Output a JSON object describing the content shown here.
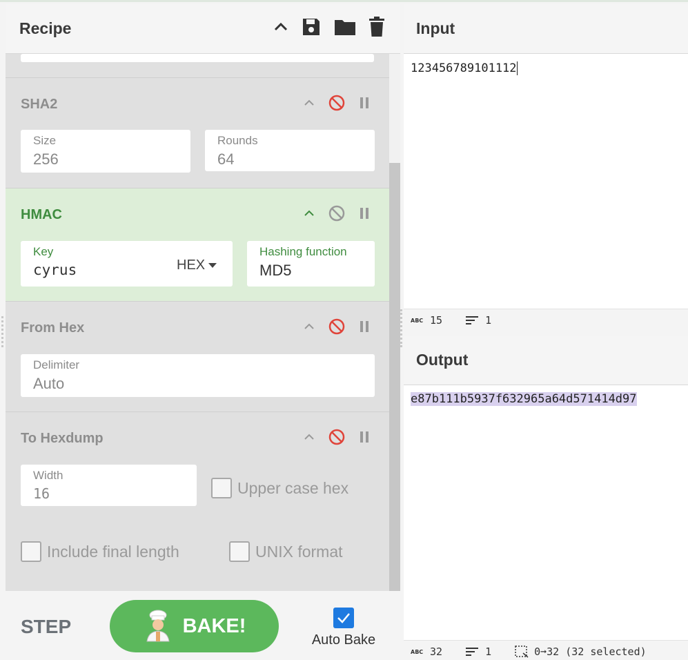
{
  "recipe": {
    "title": "Recipe",
    "operations": [
      {
        "name": "SHA2",
        "fields": [
          {
            "label": "Size",
            "value": "256"
          },
          {
            "label": "Rounds",
            "value": "64"
          }
        ]
      },
      {
        "name": "HMAC",
        "fields": [
          {
            "label": "Key",
            "value": "cyrus",
            "encoding": "HEX"
          },
          {
            "label": "Hashing function",
            "value": "MD5"
          }
        ]
      },
      {
        "name": "From Hex",
        "fields": [
          {
            "label": "Delimiter",
            "value": "Auto"
          }
        ]
      },
      {
        "name": "To Hexdump",
        "fields": [
          {
            "label": "Width",
            "value": "16"
          }
        ],
        "checkboxes": [
          {
            "label": "Upper case hex",
            "checked": false
          },
          {
            "label": "Include final length",
            "checked": false
          },
          {
            "label": "UNIX format",
            "checked": false
          }
        ]
      }
    ]
  },
  "controls": {
    "step_label": "STEP",
    "bake_label": "BAKE!",
    "auto_bake_label": "Auto Bake",
    "auto_bake_checked": true
  },
  "input": {
    "title": "Input",
    "value": "123456789101112",
    "status": {
      "length": "15",
      "lines": "1"
    }
  },
  "output": {
    "title": "Output",
    "value": "e87b111b5937f632965a64d571414d97",
    "status": {
      "length": "32",
      "lines": "1",
      "selection": "0➞32 (32 selected)"
    }
  },
  "colors": {
    "active_op_bg": "#ddeed8",
    "active_op_text": "#3f8c3f",
    "bake_green": "#5cb85c",
    "disable_red": "#e0443a",
    "checkbox_blue": "#1e7ae0",
    "selection_highlight": "#d8d0ee"
  }
}
